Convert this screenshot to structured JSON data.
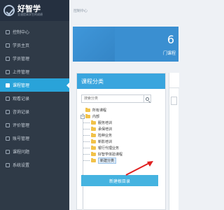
{
  "brand": {
    "name": "好智学",
    "tagline": "全速提高学生的成绩"
  },
  "sidebar": {
    "items": [
      {
        "label": "控制中心",
        "active": false,
        "icon": "dashboard-icon"
      },
      {
        "label": "学员主页",
        "active": false,
        "icon": "user-icon"
      },
      {
        "label": "学员管理",
        "active": false,
        "icon": "users-icon"
      },
      {
        "label": "上传管理",
        "active": false,
        "icon": "upload-icon"
      },
      {
        "label": "课程管理",
        "active": true,
        "icon": "course-icon"
      },
      {
        "label": "观看记录",
        "active": false,
        "icon": "eye-icon"
      },
      {
        "label": "咨询记录",
        "active": false,
        "icon": "chat-icon"
      },
      {
        "label": "评价管理",
        "active": false,
        "icon": "comment-icon"
      },
      {
        "label": "账号管理",
        "active": false,
        "icon": "account-icon"
      },
      {
        "label": "课程问题",
        "active": false,
        "icon": "question-icon"
      },
      {
        "label": "系统设置",
        "active": false,
        "icon": "gear-icon"
      }
    ]
  },
  "breadcrumb": "控制中心",
  "stat": {
    "value": "6",
    "label": "门课程"
  },
  "panel": {
    "title": "课程分类",
    "search_placeholder": "搜索分类",
    "tree": [
      {
        "label": "所有课程",
        "level": 0
      },
      {
        "label": "内部",
        "level": 0
      },
      {
        "label": "服务培训",
        "level": 1
      },
      {
        "label": "承保培训",
        "level": 1
      },
      {
        "label": "险种业务",
        "level": 1
      },
      {
        "label": "新影培训",
        "level": 1
      },
      {
        "label": "银行代理业务",
        "level": 1
      },
      {
        "label": "好智学体验课程",
        "level": 1
      },
      {
        "label": "新建分类",
        "level": 1,
        "selected": true
      }
    ],
    "new_button": "新建根目录"
  },
  "colors": {
    "sidebar": "#2f3a47",
    "accent": "#29a3d9",
    "card": "#3a8fd1",
    "button": "#45b3e0",
    "annotation": "#e02020"
  }
}
